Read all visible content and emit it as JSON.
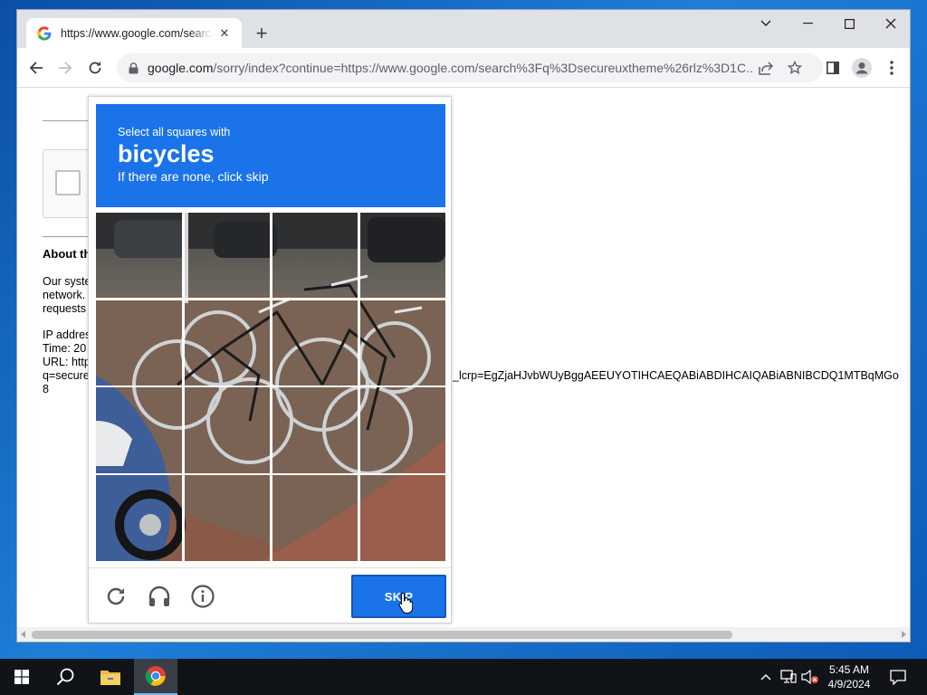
{
  "browser": {
    "tab_title": "https://www.google.com/search?q=",
    "url_host": "google.com",
    "url_rest": "/sorry/index?continue=https://www.google.com/search%3Fq%3Dsecureuxtheme%26rlz%3D1C..."
  },
  "page": {
    "heading": "About th",
    "lines_block1": [
      "Our syste",
      "network.",
      "requests"
    ],
    "lines_block2": [
      "IP addres",
      "Time: 20",
      "URL: http",
      "q=secure",
      "8"
    ],
    "url_tail": "_lcrp=EgZjaHJvbWUyBggAEEUYOTIHCAEQABiABDIHCAIQABiABNIBCDQ1MTBqMGo"
  },
  "captcha": {
    "instruction": "Select all squares with",
    "target": "bicycles",
    "subtext": "If there are none, click skip",
    "skip_label": "SKIP",
    "grid_size": 4
  },
  "taskbar": {
    "time": "5:45 AM",
    "date": "4/9/2024"
  },
  "colors": {
    "captcha_blue": "#1a73e8",
    "taskbar": "#101418"
  }
}
